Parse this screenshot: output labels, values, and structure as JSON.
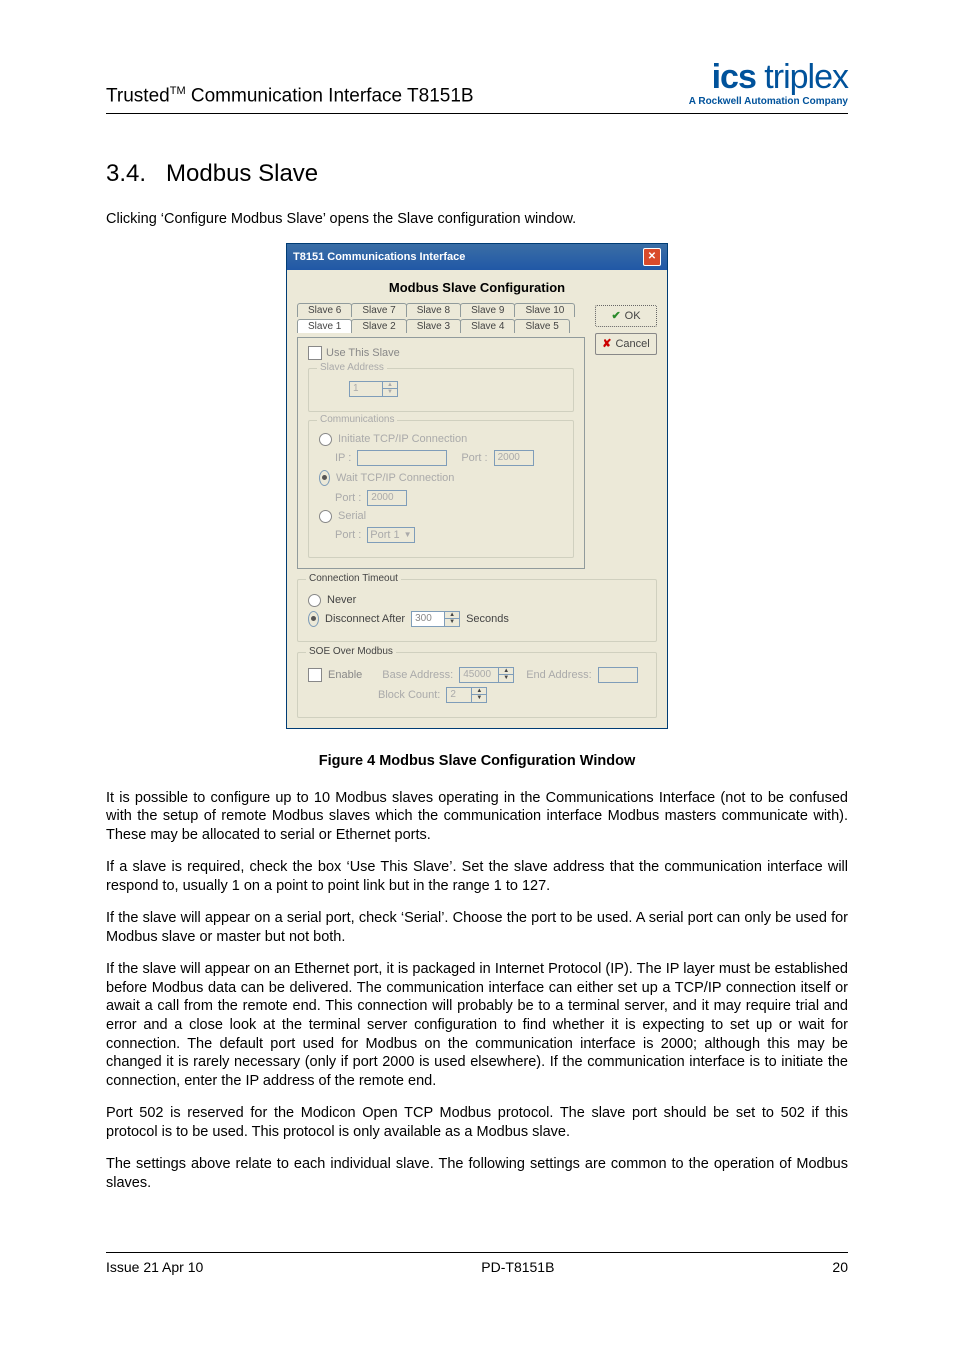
{
  "header": {
    "doc_title_prefix": "Trusted",
    "tm": "TM",
    "doc_title_suffix": "  Communication Interface T8151B",
    "logo_ics": "ics",
    "logo_triplex": " triplex",
    "tagline_a": "A ",
    "tagline_ra": "Rockwell Automation",
    "tagline_comp": " Company"
  },
  "section": {
    "num": "3.4.",
    "title": "Modbus Slave"
  },
  "intro": "Clicking ‘Configure Modbus Slave’ opens the Slave configuration window.",
  "dialog": {
    "title": "T8151 Communications Interface",
    "header": "Modbus Slave Configuration",
    "ok": "OK",
    "cancel": "Cancel",
    "tabs_row1": [
      "Slave 6",
      "Slave 7",
      "Slave 8",
      "Slave 9",
      "Slave 10"
    ],
    "tabs_row2": [
      "Slave 1",
      "Slave 2",
      "Slave 3",
      "Slave 4",
      "Slave 5"
    ],
    "use_this_slave": "Use This Slave",
    "slave_address_grp": "Slave Address",
    "slave_address_val": "1",
    "comms_grp": "Communications",
    "initiate": "Initiate TCP/IP Connection",
    "ip_lbl": "IP :",
    "ip_val": "",
    "port_lbl": "Port :",
    "port_val_top": "2000",
    "wait": "Wait TCP/IP Connection",
    "port_val_wait": "2000",
    "serial": "Serial",
    "serial_port_lbl": "Port :",
    "serial_port_val": "Port 1",
    "conn_timeout_grp": "Connection Timeout",
    "never": "Never",
    "disconnect_after": "Disconnect After",
    "disconnect_val": "300",
    "seconds": "Seconds",
    "soe_grp": "SOE Over Modbus",
    "enable": "Enable",
    "base_addr_lbl": "Base Address:",
    "base_addr_val": "45000",
    "end_addr_lbl": "End Address:",
    "end_addr_val": "",
    "block_count_lbl": "Block Count:",
    "block_count_val": "2"
  },
  "figcap": "Figure 4 Modbus Slave Configuration Window",
  "paras": [
    "It is possible to configure up to 10 Modbus slaves operating in the Communications Interface (not to be confused with the setup of remote Modbus slaves which the communication interface Modbus masters communicate with). These may be allocated to serial or Ethernet ports.",
    "If a slave is required, check the box ‘Use This Slave’. Set the slave address that the communication interface will respond to, usually 1 on a point to point link but in the range 1 to 127.",
    "If the slave will appear on a serial port, check ‘Serial’. Choose the port to be used. A serial port can only be used for Modbus slave or master but not both.",
    "If the slave will appear on an Ethernet port, it is packaged in Internet Protocol (IP). The IP layer must be established before Modbus data can be delivered. The communication interface can either set up a TCP/IP connection itself or await a call from the remote end. This connection will probably be to a terminal server, and it may require trial and error and a close look at the terminal server configuration to find whether it is expecting to set up or wait for connection. The default port used for Modbus on the communication interface is 2000; although this may be changed it is rarely necessary (only if port 2000 is used elsewhere). If the communication interface is to initiate the connection, enter the IP address of the remote end.",
    "Port 502 is reserved for the Modicon Open TCP Modbus protocol. The slave port should be set to 502 if this protocol is to be used. This protocol is only available as a Modbus slave.",
    "The settings above relate to each individual slave. The following settings are common to the operation of Modbus slaves."
  ],
  "footer": {
    "left": "Issue 21 Apr 10",
    "center": "PD-T8151B",
    "right": "20"
  }
}
